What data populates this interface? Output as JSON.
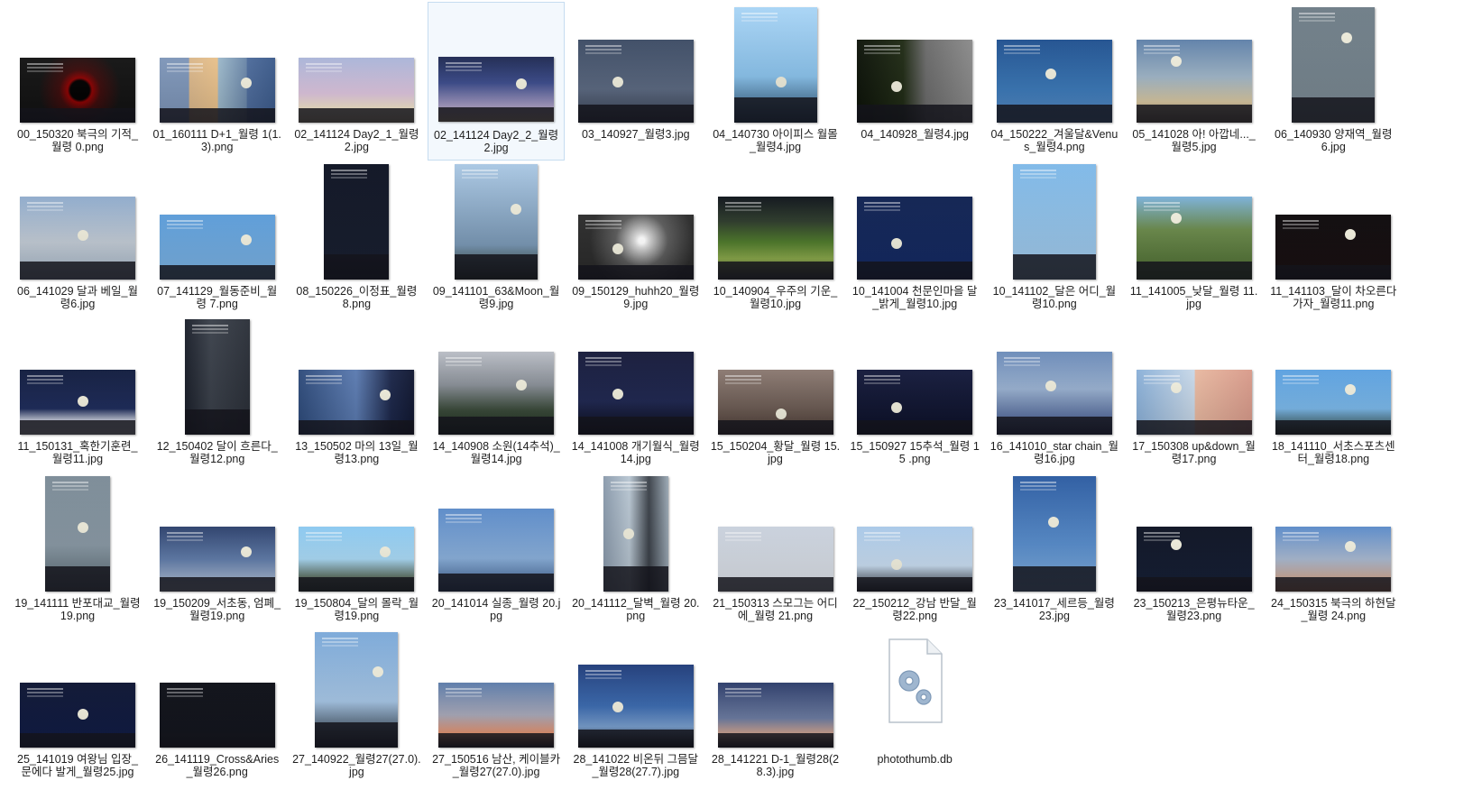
{
  "window": {
    "title": ""
  },
  "files": [
    {
      "name": "00_150320 북극의 기적_월령 0.png",
      "bg": "radial-gradient(circle at 52% 50%, #000 14%, #8a0000 18%, #3a0a0a 30%, #111 60%)",
      "moon": false
    },
    {
      "name": "01_160111 D+1_월령 1(1.3).png",
      "bg": "linear-gradient(90deg,#7d95b8 0%,#7d95b8 25%,#d9b68a 26%,#e8c08a 50%,#9bb7c9 51%,#6a86a8 75%,#4c6a9a 76%,#3b5a8a 100%)",
      "moon": true
    },
    {
      "name": "02_141124 Day2_1_월령 2.jpg",
      "bg": "linear-gradient(180deg,#a9b4d8 0%,#dcc3dc 55%,#f4e7c8 80%,#e9d8a8 100%)",
      "moon": false
    },
    {
      "name": "02_141124 Day2_2_월령 2.jpg",
      "bg": "linear-gradient(180deg,#1c2750 0%,#3a4a8a 40%,#a69cc4 75%,#e8cfa8 100%)",
      "moon": true,
      "selected": true
    },
    {
      "name": "03_140927_월령3.jpg",
      "bg": "linear-gradient(180deg,#3b4a63 0%,#5a6880 60%,#3a4252 100%)",
      "moon": true
    },
    {
      "name": "04_140730 아이피스 월몰_월령4.jpg",
      "bg": "linear-gradient(180deg,#a8d4f5 0%,#8cc5ef 60%,#264a6a 100%)",
      "moon": true
    },
    {
      "name": "04_140928_월령4.jpg",
      "bg": "linear-gradient(90deg,#0c1208 0%,#1f2a14 40%,#6a6a6a 60%,#8a8a8a 100%)",
      "moon": true
    },
    {
      "name": "04_150222_겨울달&Venus_월령4.png",
      "bg": "linear-gradient(180deg,#1e4f8e 0%,#3a78b8 60%,#5a8fc8 100%)",
      "moon": true
    },
    {
      "name": "05_141028 아! 아깝네..._월령5.jpg",
      "bg": "linear-gradient(180deg,#5d7fa8 0%,#a0b6c8 45%,#d8c7a0 75%,#8a7a60 100%)",
      "moon": true
    },
    {
      "name": "06_140930 양재역_월령 6.jpg",
      "bg": "linear-gradient(180deg,#6d7c86 0%,#7d8c96 100%)",
      "moon": true
    },
    {
      "name": "06_141029 달과 베일_월령6.jpg",
      "bg": "linear-gradient(180deg,#8eaacb 0%,#c3ccd6 55%,#a4b6c8 100%)",
      "moon": true
    },
    {
      "name": "07_141129_월동준비_월령 7.png",
      "bg": "linear-gradient(180deg,#5a9bd8 0%,#7fb6e6 100%)",
      "moon": true
    },
    {
      "name": "08_150226_이정표_월령 8.png",
      "bg": "linear-gradient(180deg,#0b1020 0%,#1a2132 100%)",
      "moon": false
    },
    {
      "name": "09_141101_63&Moon_월령9.jpg",
      "bg": "linear-gradient(180deg,#a9c7e3 0%,#7b9ab8 70%,#2c3a2a 100%)",
      "moon": true
    },
    {
      "name": "09_150129_huhh20_월령 9.jpg",
      "bg": "radial-gradient(circle at 55% 40%, #ffffff 4%, #d8d8d8 10%, #5a5a5a 35%, #2a2a2a 70%)",
      "moon": true
    },
    {
      "name": "10_140904_우주의 기운_월령10.jpg",
      "bg": "linear-gradient(180deg,#0c1118 0%,#2c3a2a 30%,#4e7a2a 55%,#8aa84a 75%,#3a3a3a 100%)",
      "moon": false
    },
    {
      "name": "10_141004 천문인마을 달_밝게_월령10.jpg",
      "bg": "linear-gradient(180deg,#0d1f4f 0%,#142b66 100%)",
      "moon": true
    },
    {
      "name": "10_141102_달은 어디_월령10.png",
      "bg": "linear-gradient(180deg,#7db8e8 0%,#a8d0f0 100%)",
      "moon": false
    },
    {
      "name": "11_141005_낮달_월령 11.jpg",
      "bg": "linear-gradient(180deg,#7ab0d8 0%,#6a8a4a 40%,#4a6a30 100%)",
      "moon": true
    },
    {
      "name": "11_141103_달이 차오른다 가자_월령11.png",
      "bg": "linear-gradient(180deg,#0a0608 0%,#1a1012 100%)",
      "moon": true
    },
    {
      "name": "11_150131_혹한기훈련_월령11.jpg",
      "bg": "linear-gradient(180deg,#0f1a3c 0%,#1c2a5a 60%,#d8dde8 80%,#eef0f4 100%)",
      "moon": true
    },
    {
      "name": "12_150402 달이 흐른다_월령12.png",
      "bg": "linear-gradient(90deg,#1a1f2a 0%,#3a404a 40%,#2a2f38 100%)",
      "moon": false
    },
    {
      "name": "13_150502 마의 13일_월령13.png",
      "bg": "linear-gradient(90deg,#2d4a7a 0%,#5a7ab0 50%,#1a2548 80%,#0f1630 100%)",
      "moon": true
    },
    {
      "name": "14_140908 소원(14추석)_월령14.jpg",
      "bg": "linear-gradient(180deg,#b8bcc4 0%,#8a9098 40%,#3a4a3a 70%,#1a2a1a 100%)",
      "moon": true
    },
    {
      "name": "14_141008 개기월식_월령 14.jpg",
      "bg": "linear-gradient(180deg,#141838 0%,#1e2650 60%,#0a0c18 100%)",
      "moon": true
    },
    {
      "name": "15_150204_황달_월령 15.jpg",
      "bg": "linear-gradient(180deg,#8a7870 0%,#6a5a52 60%,#4a3a34 100%)",
      "moon": true
    },
    {
      "name": "15_150927 15추석_월령 15 .png",
      "bg": "linear-gradient(180deg,#12183a 0%,#0c1028 100%)",
      "moon": true
    },
    {
      "name": "16_141010_star chain_월령16.jpg",
      "bg": "linear-gradient(180deg,#6a8ab8 0%,#9ab2d2 45%,#5a70a0 80%,#2a3560 100%)",
      "moon": true
    },
    {
      "name": "17_150308 up&down_월령17.png",
      "bg": "linear-gradient(90deg,#8ab0d8 0%,#c8d8e8 50%,#e8b8a0 51%,#d89a8a 100%)",
      "moon": true
    },
    {
      "name": "18_141110_서초스포츠센터_월령18.png",
      "bg": "linear-gradient(180deg,#5aa0e0 0%,#7ab8ea 60%,#2a3a2a 100%)",
      "moon": true
    },
    {
      "name": "19_141111 반포대교_월령 19.png",
      "bg": "linear-gradient(180deg,#7a8a96 0%,#8a9aa6 60%,#5a6a72 100%)",
      "moon": true
    },
    {
      "name": "19_150209_서초동, 엄폐_월령19.png",
      "bg": "linear-gradient(180deg,#2a3e6a 0%,#5e7aa8 50%,#c8d4e4 100%)",
      "moon": true
    },
    {
      "name": "19_150804_달의 몰락_월령19.png",
      "bg": "linear-gradient(180deg,#8ac8f0 0%,#a8d8f4 50%,#5a6a5a 80%,#3a4a3a 100%)",
      "moon": true
    },
    {
      "name": "20_141014 실종_월령 20.jpg",
      "bg": "linear-gradient(180deg,#5a8ac8 0%,#8ab0dc 60%,#3a5a8a 100%)",
      "moon": false
    },
    {
      "name": "20_141112_달벽_월령 20.png",
      "bg": "linear-gradient(90deg,#8a9aac 0%,#b8c6d2 40%,#3a4048 70%,#9aa8b4 100%)",
      "moon": true
    },
    {
      "name": "21_150313 스모그는 어디에_월령 21.png",
      "bg": "linear-gradient(180deg,#c8d0dc 0%,#e0e4ea 100%)",
      "moon": false
    },
    {
      "name": "22_150212_강남 반달_월령22.png",
      "bg": "linear-gradient(180deg,#a8c8e8 0%,#c8dcf0 60%,#2a2e34 100%)",
      "moon": true
    },
    {
      "name": "23_141017_세르등_월령 23.jpg",
      "bg": "linear-gradient(180deg,#2a5aa0 0%,#5a90d0 60%,#8ab8e8 100%)",
      "moon": true
    },
    {
      "name": "23_150213_은평뉴타운_월령23.png",
      "bg": "linear-gradient(180deg,#0a1020 0%,#162038 100%)",
      "moon": true
    },
    {
      "name": "24_150315 북극의 하현달_월령 24.png",
      "bg": "linear-gradient(180deg,#5a8ac8 0%,#a8b8d0 50%,#e8a070 100%)",
      "moon": true
    },
    {
      "name": "25_141019 여왕님 입장_문에다 발게_월령25.jpg",
      "bg": "linear-gradient(180deg,#0a1230 0%,#101c48 100%)",
      "moon": true
    },
    {
      "name": "26_141119_Cross&Aries_월령26.png",
      "bg": "linear-gradient(180deg,#0a0c14 0%,#14161e 100%)",
      "moon": false
    },
    {
      "name": "27_140922_월령27(27.0).jpg",
      "bg": "linear-gradient(180deg,#7aa8d8 0%,#a8c8e8 60%,#1a2028 100%)",
      "moon": true
    },
    {
      "name": "27_150516 남산, 케이블카_월령27(27.0).jpg",
      "bg": "linear-gradient(180deg,#5a7aa8 0%,#a8a8b8 50%,#e8906a 80%,#1a1a1a 100%)",
      "moon": false
    },
    {
      "name": "28_141022 비온뒤 그믐달_월령28(27.7).jpg",
      "bg": "linear-gradient(180deg,#1e3a78 0%,#3a6ab0 50%,#7aa0d0 75%,#0a0a0a 100%)",
      "moon": true
    },
    {
      "name": "28_141221 D-1_월령28(28.3).jpg",
      "bg": "linear-gradient(180deg,#2a3a68 0%,#6a7aa0 55%,#d8a890 80%,#1a1a1a 100%)",
      "moon": false
    },
    {
      "name": "photothumb.db",
      "db": true
    }
  ]
}
